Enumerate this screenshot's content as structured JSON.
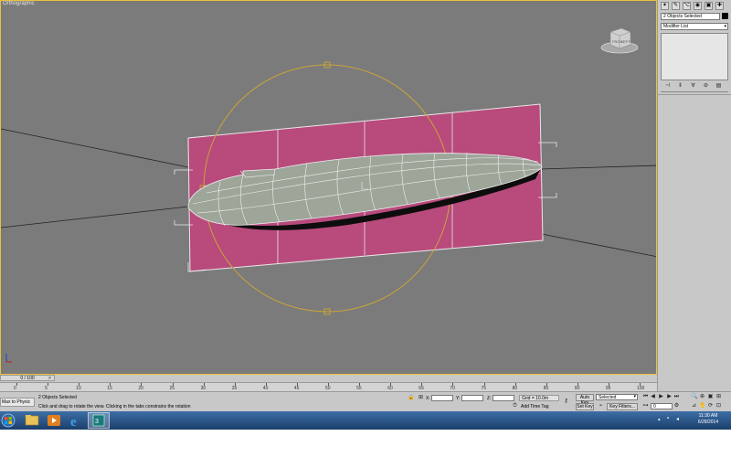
{
  "viewport": {
    "label": "Orthographic",
    "viewcube": {
      "left_label": "FRONT",
      "right_label": "LEFT"
    }
  },
  "command_panel": {
    "tab_icons": [
      "create-icon",
      "modify-icon",
      "hierarchy-icon",
      "motion-icon",
      "display-icon",
      "utilities-icon"
    ],
    "selection_field": "2 Objects Selected",
    "modifier_list": "Modifier List"
  },
  "timeline": {
    "frame_counter": "0 / 100",
    "ticks": [
      "0",
      "5",
      "10",
      "15",
      "20",
      "25",
      "30",
      "35",
      "40",
      "45",
      "50",
      "55",
      "60",
      "65",
      "70",
      "75",
      "80",
      "85",
      "90",
      "95",
      "100"
    ]
  },
  "statusbar": {
    "maxscript_label": "Max to Physic",
    "selection_status": "2 Objects Selected",
    "prompt": "Click and drag to rotate the view.  Clicking in the tabs constrains the rotation",
    "x_label": "X:",
    "y_label": "Y:",
    "z_label": "Z:",
    "grid": "Grid = 10.0m",
    "add_time_tag": "Add Time Tag",
    "auto_key": "Auto Key",
    "selected": "Selected",
    "set_key": "Set Key",
    "key_filters": "Key Filters...",
    "frame": "0"
  },
  "taskbar": {
    "apps": [
      "start-button",
      "explorer-icon",
      "media-player-icon",
      "internet-explorer-icon",
      "3dsmax-icon"
    ],
    "time": "11:30 AM",
    "date": "6/28/2014"
  },
  "colors": {
    "viewport_bg": "#7b7b7b",
    "plane": "#b84a7c",
    "hull": "#9ea69a",
    "gizmo": "#c9a33a"
  }
}
